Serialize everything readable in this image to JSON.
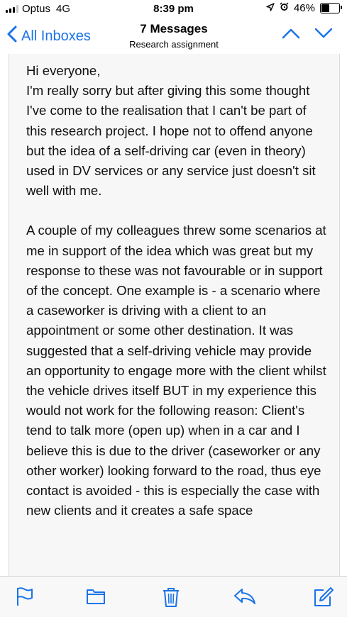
{
  "status_bar": {
    "carrier": "Optus",
    "network": "4G",
    "time": "8:39 pm",
    "battery": "46%",
    "battery_level": 0.46,
    "icons": [
      "signal-icon",
      "location-icon",
      "alarm-icon",
      "battery-icon"
    ]
  },
  "nav": {
    "back_label": "All Inboxes",
    "title": "7 Messages",
    "subtitle": "Research assignment",
    "accent_color": "#1a73e8"
  },
  "message": {
    "paragraphs": [
      "Hi everyone,\nI'm really sorry but after giving this some thought I've come to the realisation that I can't be part of this research project. I hope not to offend anyone but the idea of a self-driving car (even in theory) used in DV services or any service just doesn't sit well with me.",
      "A couple of my colleagues threw some scenarios at me in support of the idea which was great but my response to these was not favourable or in support of the concept. One example is - a scenario where a caseworker is driving with a client to an appointment or some other destination. It was suggested that a self-driving vehicle may provide an opportunity to engage more with the client whilst the vehicle drives itself BUT in my experience this would not work for the following reason: Client's tend to talk more (open up) when in a car and I believe this is due to the driver (caseworker or any other worker) looking forward to the road, thus eye contact is avoided - this is especially the case with new clients and it creates a safe space"
    ]
  },
  "toolbar": {
    "icons": [
      "flag-icon",
      "folder-icon",
      "trash-icon",
      "reply-icon",
      "compose-icon"
    ]
  }
}
